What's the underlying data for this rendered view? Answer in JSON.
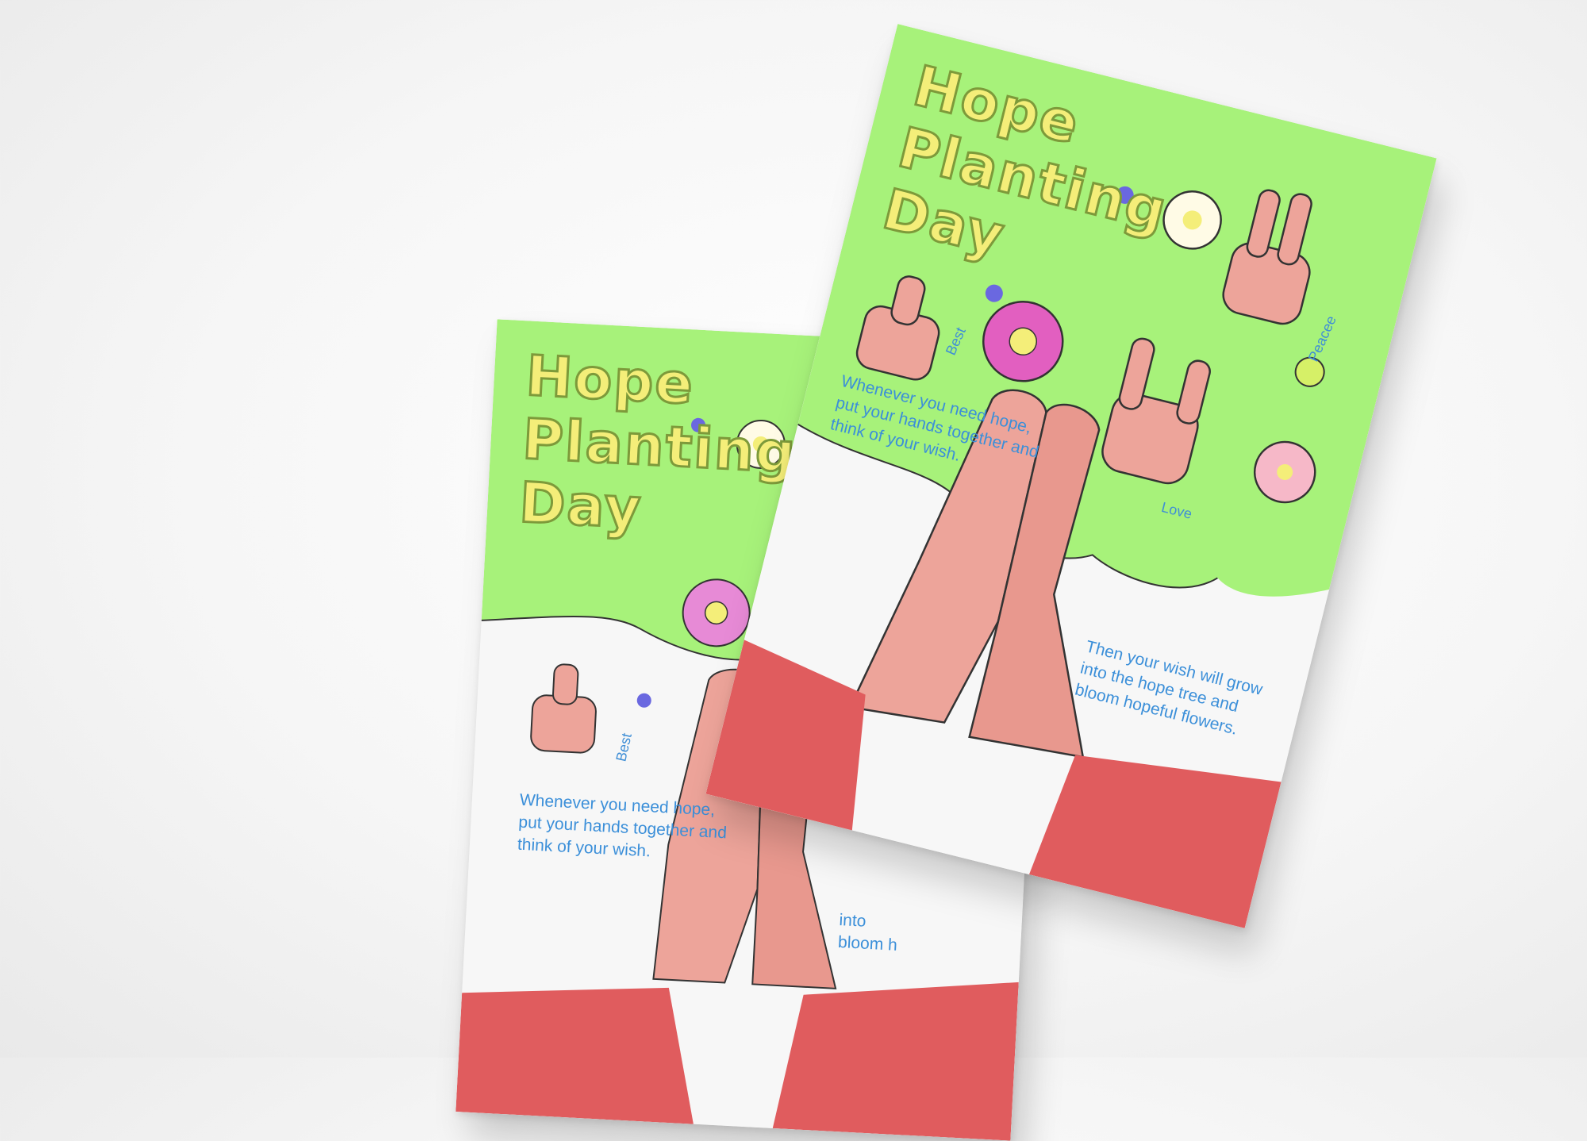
{
  "flyers": {
    "front": {
      "title": {
        "line1": "Hope",
        "line2": "Planting",
        "line3": "Day"
      },
      "labels": {
        "best": "Best",
        "peace": "Peacee",
        "love": "Love"
      },
      "text_top": "Whenever you need hope,\nput your hands together and\nthink of your wish.",
      "text_bottom": "Then your wish will grow\ninto the hope tree and\nbloom hopeful flowers."
    },
    "back": {
      "title": {
        "line1": "Hope",
        "line2": "Planting",
        "line3": "Day"
      },
      "labels": {
        "best": "Best"
      },
      "text_top": "Whenever you need hope,\nput your hands together and\nthink of your wish.",
      "text_bottom_partial": "into\nbloom h"
    }
  },
  "colors": {
    "background": "#f3f3f3",
    "green": "#a7f27a",
    "title_fill": "#f4ee79",
    "skin": "#eda49a",
    "skin_dark": "#d98279",
    "sleeve": "#e05c5e",
    "pink_flower": "#e25fc0",
    "blue_text": "#3b8fd9"
  },
  "icons": [
    "thumbs-up-icon",
    "peace-hand-icon",
    "love-hand-icon",
    "flower-icon",
    "violet-icon"
  ]
}
